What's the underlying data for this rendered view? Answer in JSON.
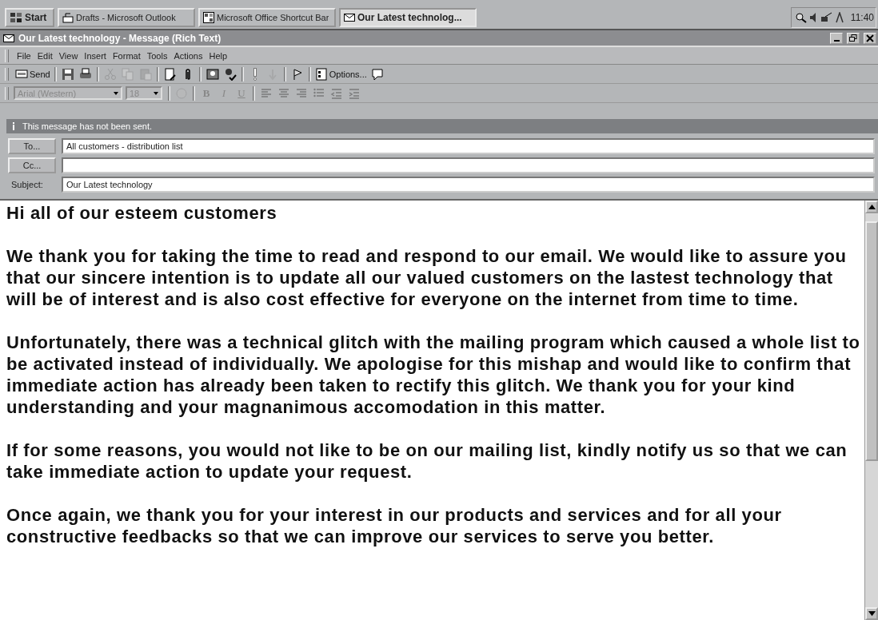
{
  "taskbar": {
    "start": "Start",
    "tasks": [
      {
        "label": "Drafts - Microsoft Outlook",
        "selected": false
      },
      {
        "label": "Microsoft Office Shortcut Bar",
        "selected": false
      },
      {
        "label": "Our Latest technolog...",
        "selected": true
      }
    ],
    "clock": "11:40"
  },
  "window": {
    "title": "Our Latest technology - Message (Rich Text)"
  },
  "menu": [
    "File",
    "Edit",
    "View",
    "Insert",
    "Format",
    "Tools",
    "Actions",
    "Help"
  ],
  "toolbar": [
    {
      "kind": "send",
      "label": "Send",
      "disabled": false
    },
    {
      "kind": "sep"
    },
    {
      "kind": "save",
      "disabled": false
    },
    {
      "kind": "print",
      "disabled": false
    },
    {
      "kind": "sep"
    },
    {
      "kind": "cut",
      "disabled": true
    },
    {
      "kind": "copy",
      "disabled": true
    },
    {
      "kind": "paste",
      "disabled": true
    },
    {
      "kind": "sep"
    },
    {
      "kind": "insert-file",
      "disabled": false
    },
    {
      "kind": "attach",
      "disabled": false
    },
    {
      "kind": "sep"
    },
    {
      "kind": "book",
      "disabled": false
    },
    {
      "kind": "check-names",
      "disabled": false
    },
    {
      "kind": "sep"
    },
    {
      "kind": "importance-high",
      "disabled": false
    },
    {
      "kind": "importance-low",
      "disabled": true
    },
    {
      "kind": "sep"
    },
    {
      "kind": "flag",
      "disabled": false
    },
    {
      "kind": "sep"
    },
    {
      "kind": "options",
      "label": "Options...",
      "disabled": false
    },
    {
      "kind": "help",
      "disabled": false
    }
  ],
  "format_bar": {
    "font": "Arial (Western)",
    "size": "18",
    "buttons": [
      "B",
      "I",
      "U"
    ]
  },
  "info_bar": "This message has not been sent.",
  "header": {
    "to_button": "To...",
    "to": "All customers - distribution list",
    "cc_button": "Cc...",
    "subject_label": "Subject:",
    "subject": "Our Latest technology"
  },
  "body": [
    "Hi all of our esteem customers",
    "We thank you for taking the time to read and respond to our email. We would like to assure you that our sincere intention is to update all our valued customers on the lastest technology that will be of interest and is also cost effective for everyone on the internet from time to time.",
    "Unfortunately, there was a technical glitch with the mailing program which caused a whole list to be activated instead of individually. We apologise for this mishap and would like to confirm that immediate action has already been taken to rectify this glitch. We thank you for your kind understanding and your magnanimous accomodation in this matter.",
    "If for some reasons, you would not like to be on our mailing list, kindly notify us so that we can take immediate action to update your request.",
    "Once again, we thank you for your interest in our products and services and for all your constructive feedbacks so that we can improve our services to serve you better."
  ]
}
